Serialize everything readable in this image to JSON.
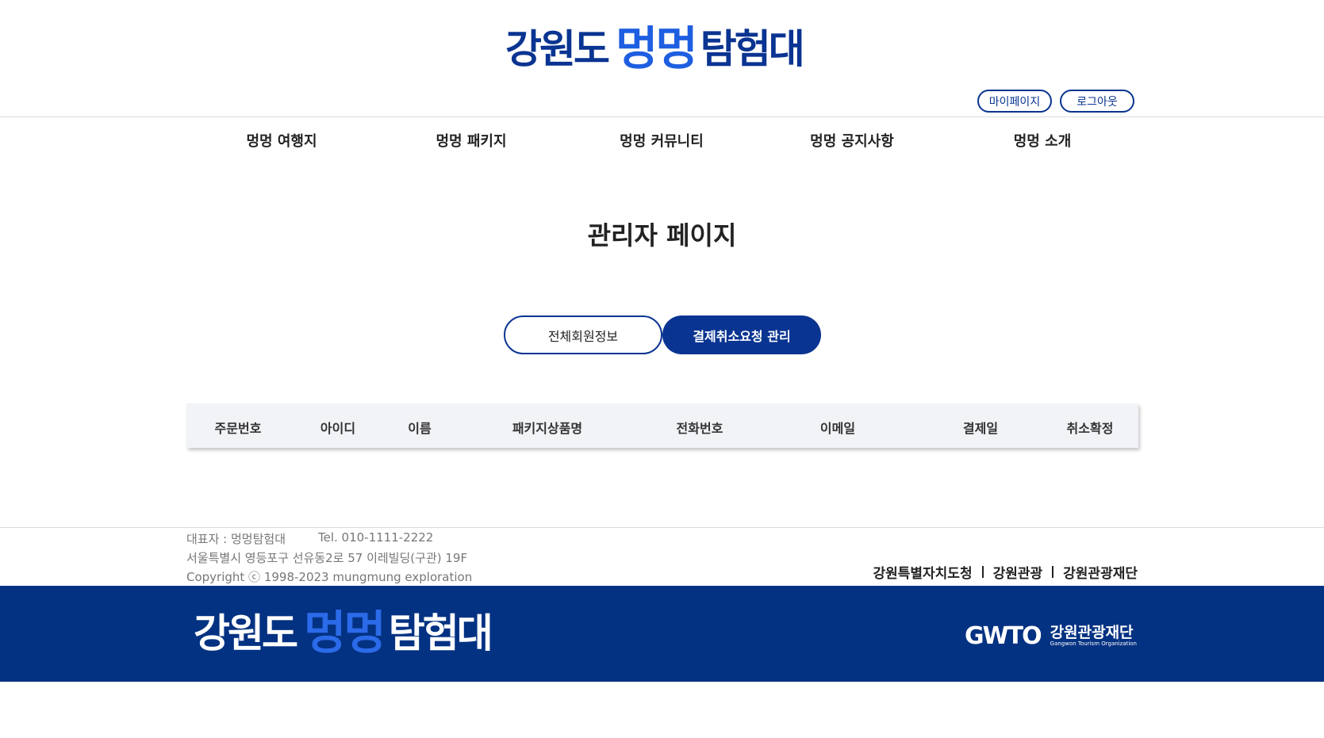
{
  "header": {
    "logo": {
      "part1": "강원도",
      "part2": "멍멍",
      "part3": "탐험대"
    },
    "mypage_label": "마이페이지",
    "logout_label": "로그아웃"
  },
  "nav": {
    "items": [
      "멍멍 여행지",
      "멍멍 패키지",
      "멍멍 커뮤니티",
      "멍멍 공지사항",
      "멍멍 소개"
    ]
  },
  "main": {
    "title": "관리자 페이지",
    "tabs": [
      {
        "label": "전체회원정보",
        "active": false
      },
      {
        "label": "결제취소요청 관리",
        "active": true
      }
    ],
    "table": {
      "columns": [
        "주문번호",
        "아이디",
        "이름",
        "패키지상품명",
        "전화번호",
        "이메일",
        "결제일",
        "취소확정"
      ]
    }
  },
  "footer": {
    "representative": "대표자 : 멍멍탐험대",
    "tel": "Tel. 010-1111-2222",
    "address": "서울특별시 영등포구 선유동2로 57 이레빌딩(구관) 19F",
    "copyright": "Copyright ⓒ 1998-2023 mungmung exploration",
    "links": [
      "강원특별자치도청",
      "강원관광",
      "강원관광재단"
    ],
    "logo": {
      "part1": "강원도",
      "part2": "멍멍",
      "part3": "탐험대"
    },
    "org_mark": "GWTO",
    "org_name": "강원관광재단",
    "org_name_en": "Gangwon Tourism Organization"
  },
  "colors": {
    "primary": "#0a3491",
    "accent": "#1e5ee0",
    "footer_bg": "#043282",
    "table_header_bg": "#f1f3f6"
  }
}
